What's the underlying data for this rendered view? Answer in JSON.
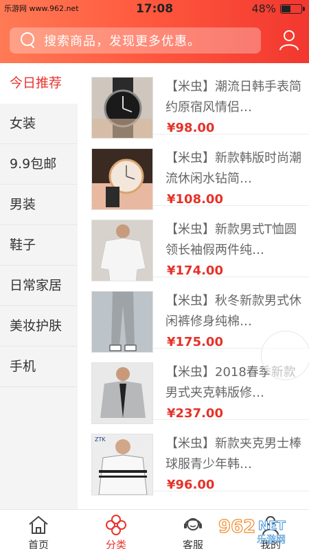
{
  "status": {
    "carrier": "乐游网 www.962.net",
    "time": "17:08",
    "battery_text": "48%",
    "battery_level": 0.48
  },
  "search": {
    "placeholder": "搜索商品，发现更多优惠。"
  },
  "sidebar": {
    "items": [
      {
        "label": "今日推荐",
        "active": true
      },
      {
        "label": "女装"
      },
      {
        "label": "9.9包邮"
      },
      {
        "label": "男装"
      },
      {
        "label": "鞋子"
      },
      {
        "label": "日常家居"
      },
      {
        "label": "美妆护肤"
      },
      {
        "label": "手机"
      }
    ]
  },
  "products": [
    {
      "title": "【米虫】潮流日韩手表简约原宿风情侣…",
      "price": "¥98.00",
      "thumb": "watch-black"
    },
    {
      "title": "【米虫】新款韩版时尚潮流休闲水钻简…",
      "price": "¥108.00",
      "thumb": "watch-rose"
    },
    {
      "title": "【米虫】新款男式T恤圆领长袖假两件纯…",
      "price": "¥174.00",
      "thumb": "white-shirt"
    },
    {
      "title": "【米虫】秋冬新款男式休闲裤修身纯棉…",
      "price": "¥175.00",
      "thumb": "grey-pants"
    },
    {
      "title": "【米虫】2018春季新款男式夹克韩版修…",
      "price": "¥237.00",
      "thumb": "grey-jacket"
    },
    {
      "title": "【米虫】新款夹克男士棒球服青少年韩…",
      "price": "¥96.00",
      "thumb": "baseball-jacket"
    }
  ],
  "tabs": [
    {
      "label": "首页",
      "icon": "home-icon"
    },
    {
      "label": "分类",
      "icon": "category-icon",
      "active": true
    },
    {
      "label": "客服",
      "icon": "customer-service-icon"
    },
    {
      "label": "我的",
      "icon": "user-icon"
    }
  ],
  "watermark": {
    "text": "962.NET 乐游网"
  },
  "colors": {
    "accent": "#e8332e",
    "header_start": "#ff7a55",
    "header_end": "#f2372f",
    "price": "#e53228"
  }
}
